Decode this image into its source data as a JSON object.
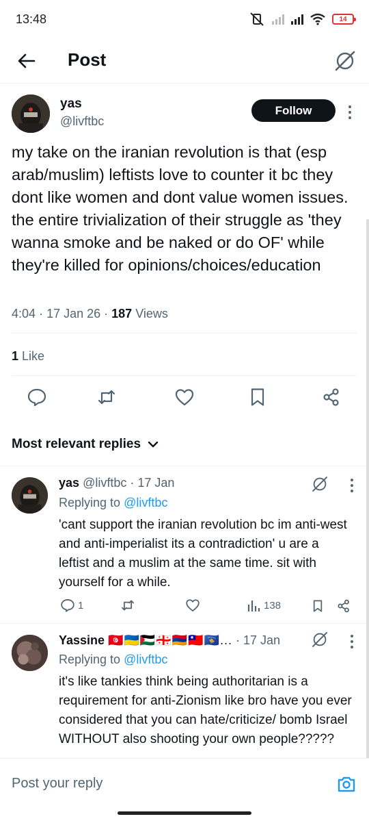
{
  "status_bar": {
    "time": "13:48",
    "battery": "14"
  },
  "header": {
    "title": "Post"
  },
  "post": {
    "name": "yas",
    "handle": "@livftbc",
    "follow_label": "Follow",
    "text": "my take on the iranian revolution is that (esp arab/muslim) leftists love to counter it bc they dont like women and dont value women issues. the entire trivialization of their struggle as 'they wanna smoke and be naked or do OF' while they're killed for opinions/choices/education",
    "time": "4:04",
    "date": "17 Jan 26",
    "views_count": "187",
    "views_label": "Views",
    "likes_count": "1",
    "likes_label": "Like"
  },
  "replies_filter": {
    "label": "Most relevant replies"
  },
  "replies": [
    {
      "name": "yas",
      "handle_date": "@livftbc · 17 Jan",
      "replying_prefix": "Replying to",
      "replying_handle": "@livftbc",
      "text": "'cant support the iranian revolution bc im anti-west and anti-imperialist its a contradiction' u are a leftist and a muslim at the same time. sit with yourself for a while.",
      "reply_count": "1",
      "views": "138"
    },
    {
      "name": "Yassine",
      "flags": "🇹🇳🇺🇦🇵🇸🇬🇪🇦🇲🇹🇼🇽🇰...",
      "handle_date": "· 17 Jan",
      "replying_prefix": "Replying to",
      "replying_handle": "@livftbc",
      "text": "it's like tankies think being authoritarian is a requirement for anti-Zionism like bro have you ever considered that you can hate/criticize/ bomb Israel WITHOUT also shooting your own people?????"
    }
  ],
  "reply_box": {
    "placeholder": "Post your reply"
  },
  "colors": {
    "accent": "#1d9bf0",
    "text": "#0f1419",
    "muted": "#536471",
    "battery": "#dd3333"
  },
  "icons": [
    "back-arrow-icon",
    "grok-icon",
    "reply-icon",
    "repost-icon",
    "like-icon",
    "bookmark-icon",
    "share-icon",
    "chevron-down-icon",
    "views-icon",
    "camera-icon"
  ]
}
